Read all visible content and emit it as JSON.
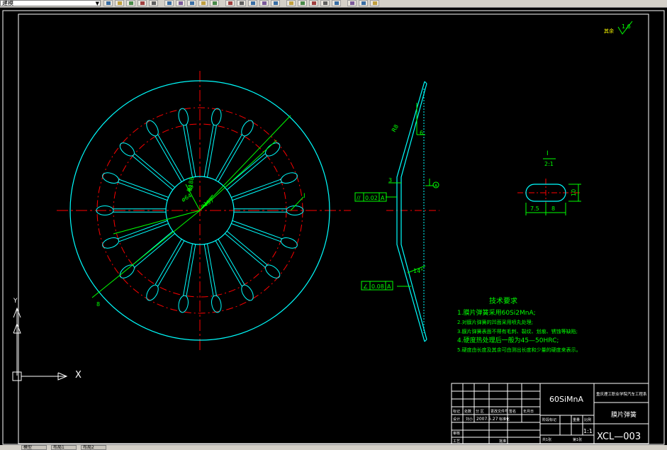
{
  "app": {
    "layer_combo_value": "建模",
    "toolbar_icons": [
      "layer-states-icon",
      "layer-icon",
      "new-icon",
      "open-icon",
      "save-icon",
      "print-icon",
      "preview-icon",
      "cut-icon",
      "copy-icon",
      "paste-icon",
      "match-icon",
      "undo-icon",
      "redo-icon",
      "pan-icon",
      "zoom-icon",
      "zoom-window-icon",
      "zoom-prev-icon",
      "properties-icon",
      "design-center-icon",
      "tool-palette-icon",
      "markup-icon",
      "calc-icon",
      "help-icon"
    ],
    "layout_tabs": [
      "模型",
      "布局1",
      "布局2"
    ]
  },
  "drawing": {
    "roughness_label": "其余",
    "roughness_value": "1.6",
    "front_view": {
      "dim_r8": "R8",
      "dim_dia64": "ø64",
      "dim_dia157": "ø157",
      "dim_dia188": "ø188",
      "dim_8": "8",
      "section_mark": "I"
    },
    "side_view": {
      "dim_r8": "R8",
      "dim_6": "6",
      "dim_3": "3",
      "flatness_symbol": "//",
      "flatness_tol": "0.02",
      "flatness_datum": "A",
      "angularity_symbol": "∠",
      "angularity_tol": "0.08",
      "angularity_datum": "A",
      "angle": "14°",
      "datum_mark": "A"
    },
    "detail_view": {
      "label_top": "I",
      "label_scale": "2:1",
      "dim_10": "10",
      "dim_7_5": "7.5",
      "dim_8": "8"
    },
    "tech_requirements": {
      "heading": "技术要求",
      "items": [
        "1.膜片弹簧采用60Si2MnA;",
        "2.对膜片弹簧的凹面采用喷丸处理;",
        "3.膜片弹簧表面不得有毛刺、裂纹、划痕、锈蚀等缺陷;",
        "4.硬度热处理后一般为45—50HRC;",
        "5.硬度由长度及其余可由测出长度和少量的硬度来表示。"
      ]
    },
    "title_block": {
      "material": "60SiMnA",
      "institution": "重庆理工职业学院汽车工程系",
      "part_name": "膜片弹簧",
      "drawing_no": "XCL—003",
      "scale": "1:1",
      "row_biaoji": "标记",
      "row_chushu": "处数",
      "row_fenqu": "分 区",
      "row_gengwai": "更改文件号",
      "row_qianming": "签名",
      "row_riqi": "年月日",
      "row_sheji": "设计",
      "designer": "刘小",
      "date": "2007.5.27",
      "row_biaozhunhua": "标准化",
      "row_shenhe": "审核",
      "row_gongyi": "工艺",
      "row_pizhun": "批准",
      "row_jieduan": "阶段标记",
      "row_zhongliang": "重量",
      "row_bili": "比例",
      "sheet_total": "共1张",
      "sheet_no": "第1张"
    }
  },
  "ucs": {
    "x_label": "X",
    "y_label": "Y"
  },
  "colors": {
    "background": "#000000",
    "frame": "#ffffff",
    "outline_cyan": "#00ffff",
    "center_red": "#ff0000",
    "dimension_green": "#00ff00",
    "annotation_yellow": "#ffff00"
  }
}
